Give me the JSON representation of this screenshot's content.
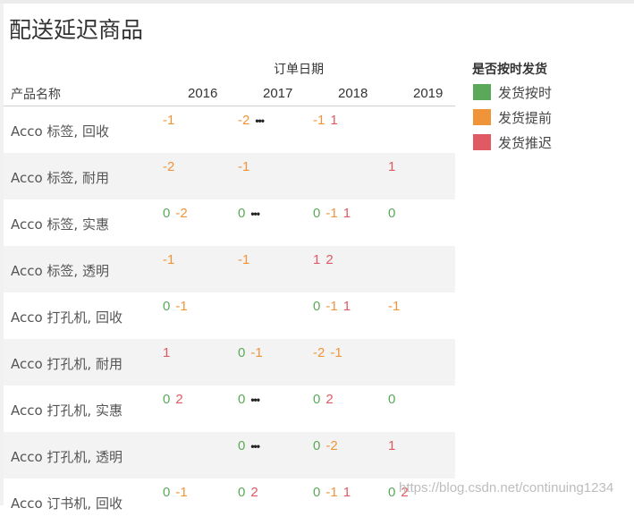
{
  "title": "配送延迟商品",
  "column_group_header": "订单日期",
  "row_header": "产品名称",
  "years": [
    "2016",
    "2017",
    "2018",
    "2019"
  ],
  "legend": {
    "title": "是否按时发货",
    "items": [
      {
        "label": "发货按时",
        "color": "#5aa95a"
      },
      {
        "label": "发货提前",
        "color": "#f0943a"
      },
      {
        "label": "发货推迟",
        "color": "#e05a63"
      }
    ]
  },
  "rows": [
    {
      "name": "Acco 标签, 回收",
      "cells": [
        [
          {
            "t": "-1",
            "c": "early"
          }
        ],
        [
          {
            "t": "-2",
            "c": "early"
          },
          {
            "t": "•••",
            "c": "dots"
          }
        ],
        [
          {
            "t": "-1",
            "c": "early"
          },
          {
            "t": "1",
            "c": "late"
          }
        ],
        []
      ]
    },
    {
      "name": "Acco 标签, 耐用",
      "cells": [
        [
          {
            "t": "-2",
            "c": "early"
          }
        ],
        [
          {
            "t": "-1",
            "c": "early"
          }
        ],
        [],
        [
          {
            "t": "1",
            "c": "late"
          }
        ]
      ]
    },
    {
      "name": "Acco 标签, 实惠",
      "cells": [
        [
          {
            "t": "0",
            "c": "ontime"
          },
          {
            "t": "-2",
            "c": "early"
          }
        ],
        [
          {
            "t": "0",
            "c": "ontime"
          },
          {
            "t": "•••",
            "c": "dots"
          }
        ],
        [
          {
            "t": "0",
            "c": "ontime"
          },
          {
            "t": "-1",
            "c": "early"
          },
          {
            "t": "1",
            "c": "late"
          }
        ],
        [
          {
            "t": "0",
            "c": "ontime"
          }
        ]
      ]
    },
    {
      "name": "Acco 标签, 透明",
      "cells": [
        [
          {
            "t": "-1",
            "c": "early"
          }
        ],
        [
          {
            "t": "-1",
            "c": "early"
          }
        ],
        [
          {
            "t": "1",
            "c": "late"
          },
          {
            "t": "2",
            "c": "late"
          }
        ],
        []
      ]
    },
    {
      "name": "Acco 打孔机, 回收",
      "cells": [
        [
          {
            "t": "0",
            "c": "ontime"
          },
          {
            "t": "-1",
            "c": "early"
          }
        ],
        [],
        [
          {
            "t": "0",
            "c": "ontime"
          },
          {
            "t": "-1",
            "c": "early"
          },
          {
            "t": "1",
            "c": "late"
          }
        ],
        [
          {
            "t": "-1",
            "c": "early"
          }
        ]
      ]
    },
    {
      "name": "Acco 打孔机, 耐用",
      "cells": [
        [
          {
            "t": "1",
            "c": "late"
          }
        ],
        [
          {
            "t": "0",
            "c": "ontime"
          },
          {
            "t": "-1",
            "c": "early"
          }
        ],
        [
          {
            "t": "-2",
            "c": "early"
          },
          {
            "t": "-1",
            "c": "early"
          }
        ],
        []
      ]
    },
    {
      "name": "Acco 打孔机, 实惠",
      "cells": [
        [
          {
            "t": "0",
            "c": "ontime"
          },
          {
            "t": "2",
            "c": "late"
          }
        ],
        [
          {
            "t": "0",
            "c": "ontime"
          },
          {
            "t": "•••",
            "c": "dots"
          }
        ],
        [
          {
            "t": "0",
            "c": "ontime"
          },
          {
            "t": "2",
            "c": "late"
          }
        ],
        [
          {
            "t": "0",
            "c": "ontime"
          }
        ]
      ]
    },
    {
      "name": "Acco 打孔机, 透明",
      "cells": [
        [],
        [
          {
            "t": "0",
            "c": "ontime"
          },
          {
            "t": "•••",
            "c": "dots"
          }
        ],
        [
          {
            "t": "0",
            "c": "ontime"
          },
          {
            "t": "-2",
            "c": "early"
          }
        ],
        [
          {
            "t": "1",
            "c": "late"
          }
        ]
      ]
    },
    {
      "name": "Acco 订书机, 回收",
      "cells": [
        [
          {
            "t": "0",
            "c": "ontime"
          },
          {
            "t": "-1",
            "c": "early"
          }
        ],
        [
          {
            "t": "0",
            "c": "ontime"
          },
          {
            "t": "2",
            "c": "late"
          }
        ],
        [
          {
            "t": "0",
            "c": "ontime"
          },
          {
            "t": "-1",
            "c": "early"
          },
          {
            "t": "1",
            "c": "late"
          }
        ],
        [
          {
            "t": "0",
            "c": "ontime"
          },
          {
            "t": "2",
            "c": "late"
          }
        ]
      ]
    }
  ],
  "watermark": "https://blog.csdn.net/continuing1234"
}
